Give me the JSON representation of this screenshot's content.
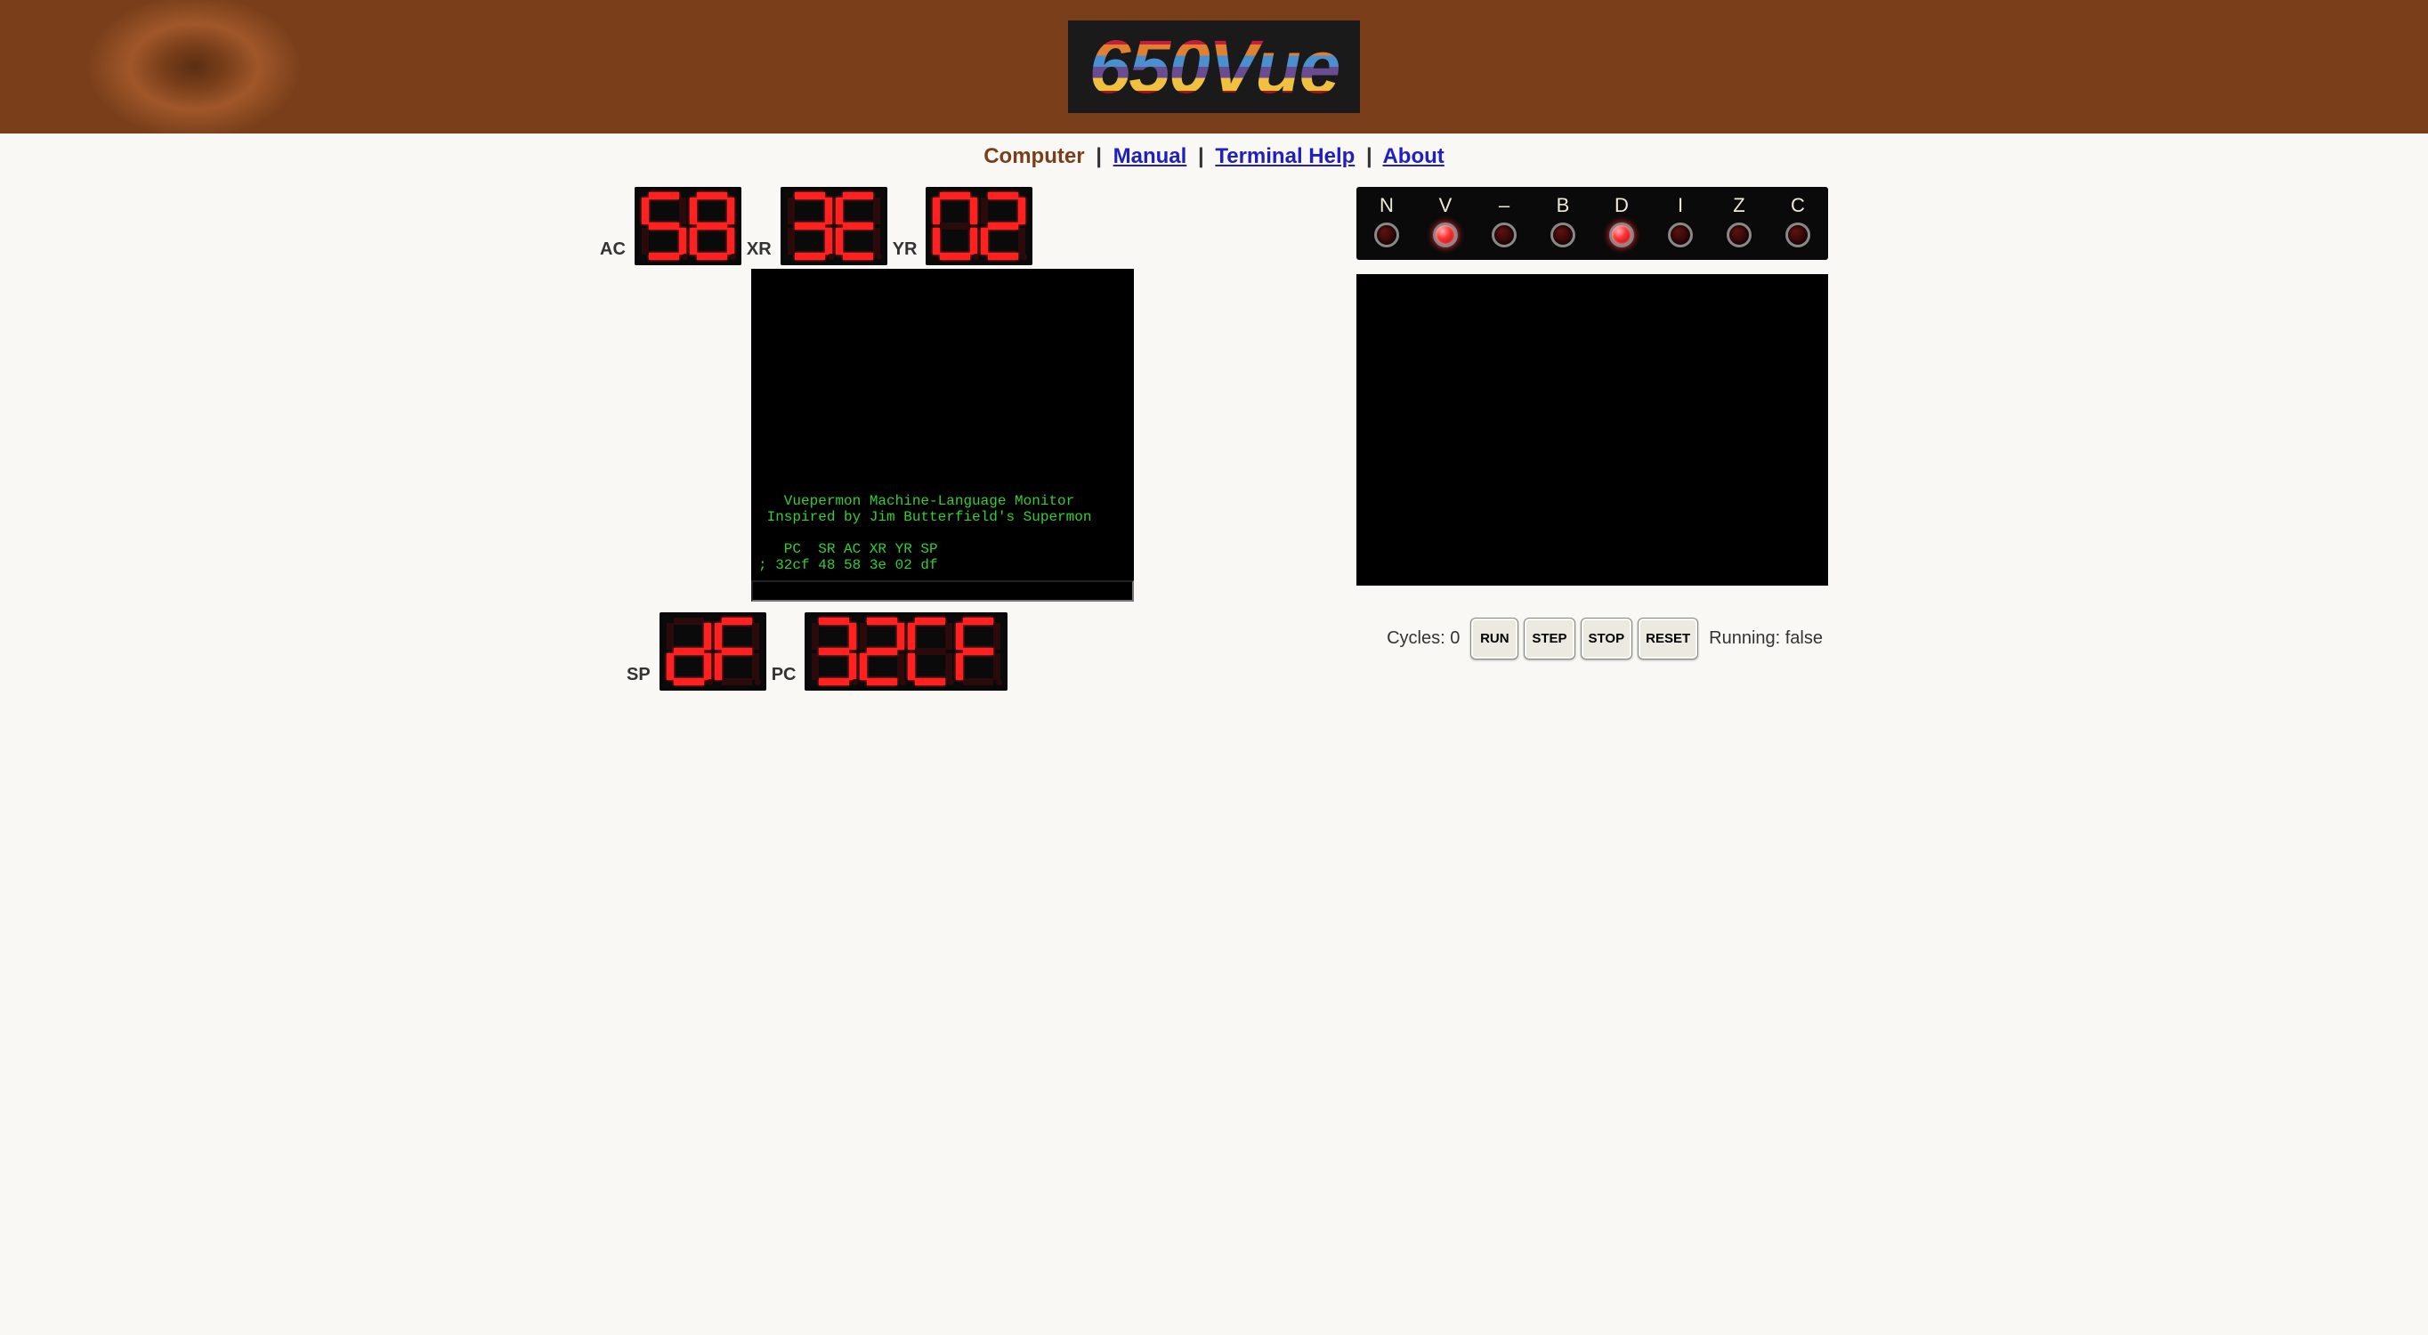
{
  "logo": "650Vue",
  "nav": {
    "active": "Computer",
    "links": [
      "Manual",
      "Terminal Help",
      "About"
    ]
  },
  "registers": {
    "ac": {
      "label": "AC",
      "value": "58"
    },
    "xr": {
      "label": "XR",
      "value": "3E"
    },
    "yr": {
      "label": "YR",
      "value": "02"
    },
    "sp": {
      "label": "SP",
      "value": "dF"
    },
    "pc": {
      "label": "PC",
      "value": "32CF"
    }
  },
  "terminal": {
    "lines": [
      "   Vuepermon Machine-Language Monitor",
      " Inspired by Jim Butterfield's Supermon",
      "",
      "   PC  SR AC XR YR SP",
      "; 32cf 48 58 3e 02 df"
    ],
    "input_value": ""
  },
  "flags": {
    "items": [
      {
        "name": "N",
        "on": false
      },
      {
        "name": "V",
        "on": true
      },
      {
        "name": "–",
        "on": false
      },
      {
        "name": "B",
        "on": false
      },
      {
        "name": "D",
        "on": true
      },
      {
        "name": "I",
        "on": false
      },
      {
        "name": "Z",
        "on": false
      },
      {
        "name": "C",
        "on": false
      }
    ]
  },
  "status": {
    "cycles_label": "Cycles:",
    "cycles": 0,
    "running_label": "Running:",
    "running": "false"
  },
  "buttons": {
    "run": "RUN",
    "step": "STEP",
    "stop": "STOP",
    "reset": "RESET"
  }
}
